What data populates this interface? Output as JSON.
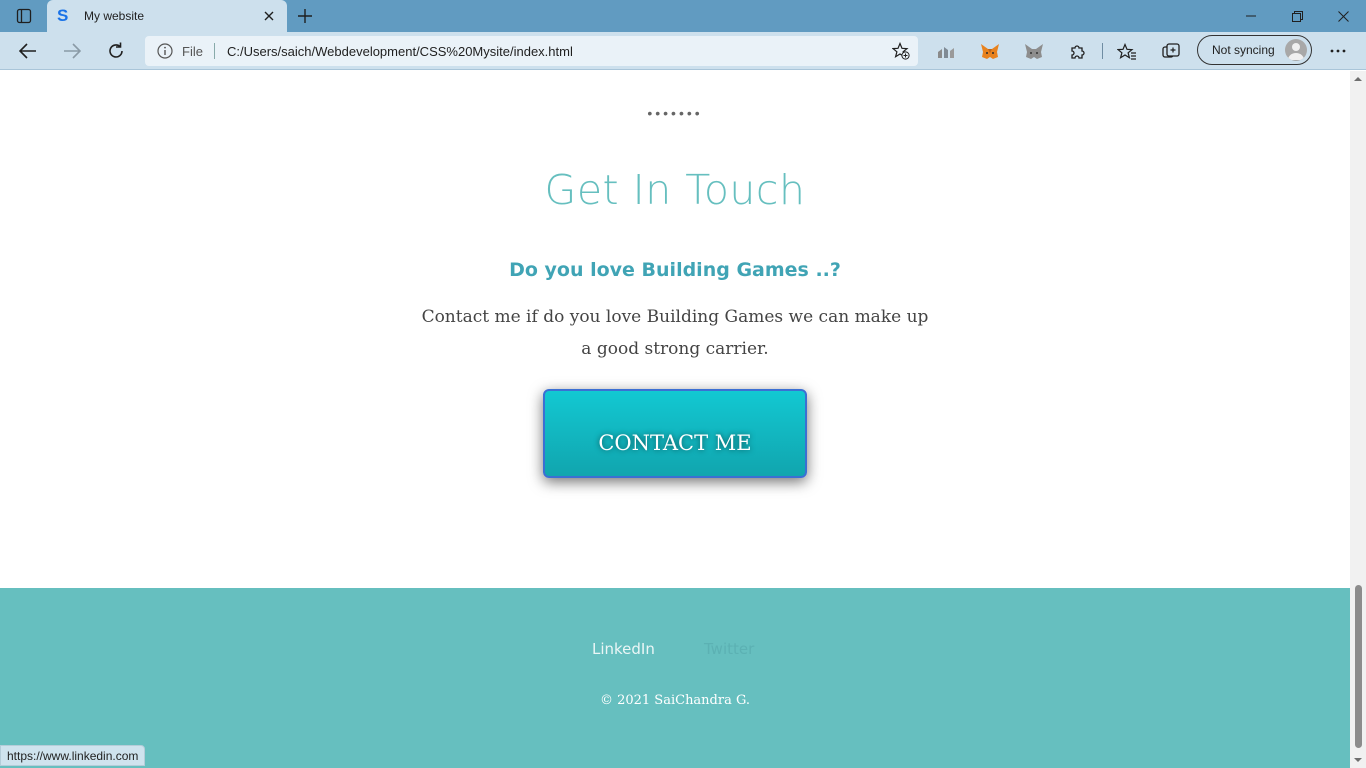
{
  "browser": {
    "tab_title": "My website",
    "address_scheme": "File",
    "url": "C:/Users/saich/Webdevelopment/CSS%20Mysite/index.html",
    "profile_label": "Not syncing",
    "status_url": "https://www.linkedin.com",
    "icons": [
      "tab-actions-icon",
      "favicon-icon",
      "close-icon",
      "plus-icon",
      "minimize-icon",
      "restore-icon",
      "window-close-icon",
      "back-icon",
      "forward-icon",
      "refresh-icon",
      "info-icon",
      "add-favorite-icon",
      "extension-chart-icon",
      "metamask-icon",
      "fox-gray-icon",
      "puzzle-icon",
      "favorites-icon",
      "collections-icon",
      "avatar-icon",
      "more-icon"
    ]
  },
  "page": {
    "dots": "•••••••",
    "heading": "Get In Touch",
    "subheading": "Do you love Building Games ..?",
    "paragraph": "Contact me if do you love Building Games we can make up a good strong carrier.",
    "cta_label": "CONTACT ME",
    "footer": {
      "links": [
        "LinkedIn",
        "Twitter"
      ],
      "copyright": "© 2021 SaiChandra G."
    }
  },
  "colors": {
    "accent": "#66bfbf",
    "subheading": "#40a4b5",
    "cta_top": "#12c8d2",
    "cta_bottom": "#11a5ae",
    "titlebar": "#619bc1",
    "toolbar": "#cde0ed"
  }
}
